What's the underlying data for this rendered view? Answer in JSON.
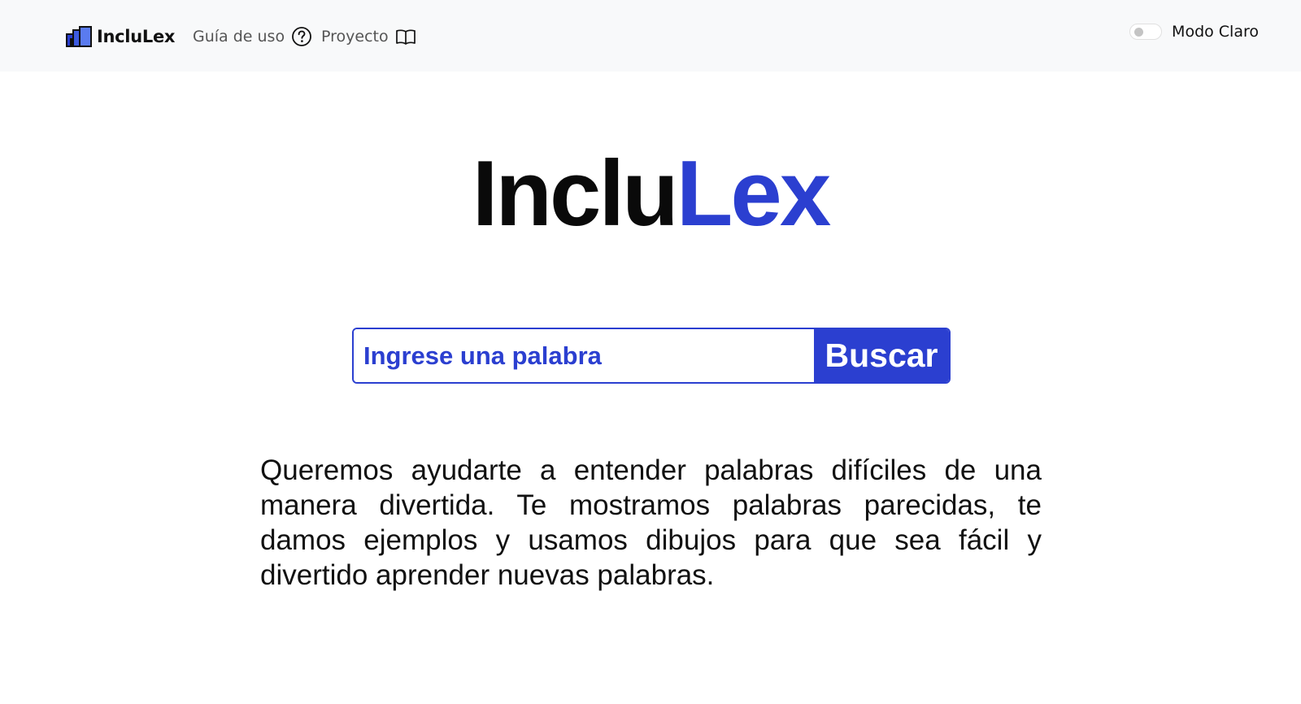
{
  "header": {
    "brand": "IncluLex",
    "brand_logo_icon": "building-blocks-icon",
    "nav": [
      {
        "label": "Guía de uso",
        "icon": "question-circle-icon"
      },
      {
        "label": "Proyecto",
        "icon": "open-book-icon"
      }
    ],
    "mode_toggle": {
      "label": "Modo Claro",
      "checked": false
    }
  },
  "hero": {
    "title_part1": "Inclu",
    "title_part2": "Lex"
  },
  "search": {
    "placeholder": "Ingrese una palabra",
    "button_label": "Buscar"
  },
  "description": "Queremos ayudarte a entender palabras difíciles de una manera divertida. Te mostramos palabras parecidas, te damos ejemplos y usamos dibujos para que sea fácil y divertido aprender nuevas palabras.",
  "colors": {
    "accent": "#2b3fd0",
    "topbar_bg": "#f8f9fa",
    "text": "#111111"
  }
}
